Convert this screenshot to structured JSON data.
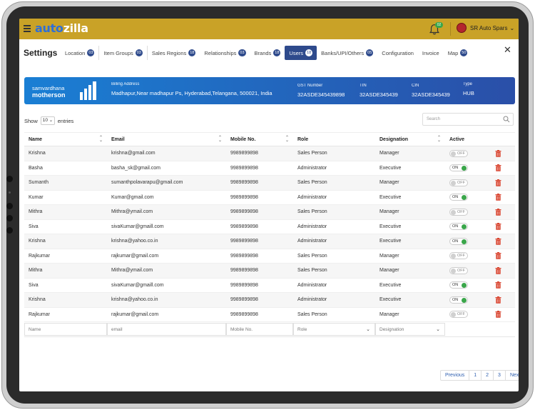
{
  "header": {
    "logo_part1": "auto",
    "logo_part2": "zilla",
    "notification_count": "02",
    "company_name": "SR Auto Spars",
    "brand_color": "#c9a227"
  },
  "page": {
    "title": "Settings",
    "tabs": [
      {
        "label": "Location",
        "badge": "03"
      },
      {
        "label": "Item Groups",
        "badge": "03"
      },
      {
        "label": "Sales Regions",
        "badge": "18"
      },
      {
        "label": "Relationships",
        "badge": "03"
      },
      {
        "label": "Brands",
        "badge": "18"
      },
      {
        "label": "Users",
        "badge": "18"
      },
      {
        "label": "Banks/UPI/Others",
        "badge": "05"
      },
      {
        "label": "Configuration",
        "badge": ""
      },
      {
        "label": "Invoice",
        "badge": ""
      },
      {
        "label": "Map",
        "badge": "50"
      }
    ],
    "active_tab": "Users"
  },
  "banner": {
    "brand_line1": "samvardhana",
    "brand_line2": "motherson",
    "billing_address_label": "Billing Address",
    "billing_address": "Madhapur,Near madhapur Ps, Hyderabad,Telangana, 500021, India",
    "gst_label": "GST Number",
    "gst": "32ASDE345439898",
    "tin_label": "TIN",
    "tin": "32ASDE345439",
    "cin_label": "CIN",
    "cin": "32ASDE345439",
    "type_label": "Type",
    "type": "HUB"
  },
  "controls": {
    "show_label": "Show",
    "entries_value": "10",
    "entries_label": "entries",
    "search_placeholder": "Search"
  },
  "table": {
    "columns": [
      "Name",
      "Email",
      "Mobile No.",
      "Role",
      "Designation",
      "Active"
    ],
    "rows": [
      {
        "name": "Krishna",
        "email": "krishna@gmail.com",
        "mobile": "9989899898",
        "role": "Sales Person",
        "designation": "Manager",
        "active": "OFF"
      },
      {
        "name": "Basha",
        "email": "basha_sk@gmail.com",
        "mobile": "9989899898",
        "role": "Administrator",
        "designation": "Executive",
        "active": "ON"
      },
      {
        "name": "Sumanth",
        "email": "sumanthpolavarapu@gmail.com",
        "mobile": "9989899898",
        "role": "Sales Person",
        "designation": "Manager",
        "active": "OFF"
      },
      {
        "name": "Kumar",
        "email": "Kumar@gmail.com",
        "mobile": "9989899898",
        "role": "Administrator",
        "designation": "Executive",
        "active": "ON"
      },
      {
        "name": "Mithra",
        "email": "Mithra@ymail.com",
        "mobile": "9989899898",
        "role": "Sales Person",
        "designation": "Manager",
        "active": "OFF"
      },
      {
        "name": "Siva",
        "email": "sivaKumar@gmaill.com",
        "mobile": "9989899898",
        "role": "Administrator",
        "designation": "Executive",
        "active": "ON"
      },
      {
        "name": "Krishna",
        "email": "krishna@yahoo.co.in",
        "mobile": "9989899898",
        "role": "Administrator",
        "designation": "Executive",
        "active": "ON"
      },
      {
        "name": "Rajkumar",
        "email": "rajkumar@gmail.com",
        "mobile": "9989899898",
        "role": "Sales Person",
        "designation": "Manager",
        "active": "OFF"
      },
      {
        "name": "Mithra",
        "email": "Mithra@ymail.com",
        "mobile": "9989899898",
        "role": "Sales Person",
        "designation": "Manager",
        "active": "OFF"
      },
      {
        "name": "Siva",
        "email": "sivaKumar@gmaill.com",
        "mobile": "9989899898",
        "role": "Administrator",
        "designation": "Executive",
        "active": "ON"
      },
      {
        "name": "Krishna",
        "email": "krishna@yahoo.co.in",
        "mobile": "9989899898",
        "role": "Administrator",
        "designation": "Executive",
        "active": "ON"
      },
      {
        "name": "Rajkumar",
        "email": "rajkumar@gmail.com",
        "mobile": "9989899898",
        "role": "Sales Person",
        "designation": "Manager",
        "active": "OFF"
      }
    ],
    "filters": {
      "name": "Name",
      "email": "email",
      "mobile": "Mobile No.",
      "role": "Role",
      "designation": "Designation"
    }
  },
  "pagination": {
    "items": [
      "Previous",
      "1",
      "2",
      "3",
      "Next"
    ]
  }
}
